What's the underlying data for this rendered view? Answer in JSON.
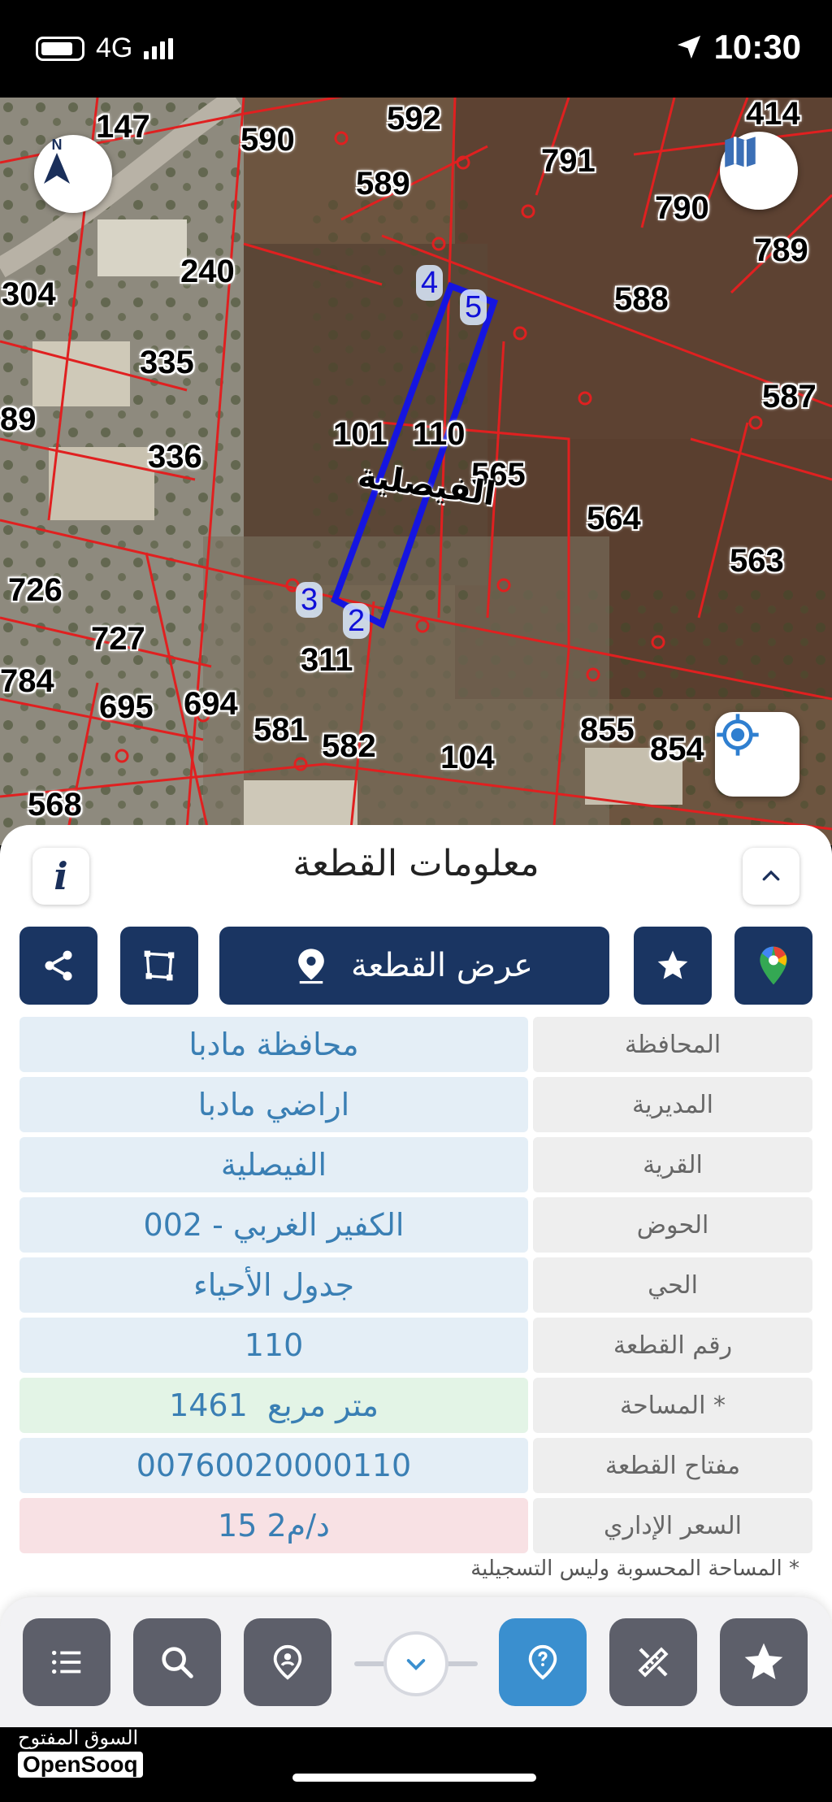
{
  "status_bar": {
    "network": "4G",
    "time": "10:30"
  },
  "map": {
    "parcel_numbers": [
      "147",
      "590",
      "592",
      "414",
      "791",
      "589",
      "790",
      "789",
      "240",
      "304",
      "588",
      "335",
      "587",
      "89",
      "101",
      "110",
      "336",
      "565",
      "564",
      "563",
      "726",
      "311",
      "727",
      "784",
      "695",
      "694",
      "581",
      "582",
      "104",
      "855",
      "854",
      "568"
    ],
    "village_label": "الفيصلية",
    "vertices": [
      "4",
      "5",
      "3",
      "2"
    ],
    "buttons": {
      "north": "compass-icon",
      "layers": "map-icon",
      "locate": "locate-icon"
    }
  },
  "panel": {
    "title": "معلومات القطعة",
    "info_label": "i",
    "view_button_label": "عرض القطعة",
    "rows": [
      {
        "label": "المحافظة",
        "value": "محافظة مادبا"
      },
      {
        "label": "المديرية",
        "value": "اراضي مادبا"
      },
      {
        "label": "القرية",
        "value": "الفيصلية"
      },
      {
        "label": "الحوض",
        "value": "الكفير الغربي - 002"
      },
      {
        "label": "الحي",
        "value": "جدول الأحياء"
      },
      {
        "label": "رقم القطعة",
        "value": "110"
      },
      {
        "label": "المساحة *",
        "value": "1461  متر مربع"
      },
      {
        "label": "مفتاح القطعة",
        "value": "00760020000110"
      },
      {
        "label": "السعر الإداري",
        "value": "15 د/م2"
      }
    ],
    "footnote": "* المساحة المحسوبة وليس التسجيلية"
  },
  "brand": {
    "arabic": "السوق المفتوح",
    "english": "OpenSooq"
  },
  "colors": {
    "navy": "#1a3562",
    "accent": "#3a8fcf",
    "value_text": "#3a7fb4",
    "parcel_line": "#e02020",
    "selection": "#1515e0"
  }
}
